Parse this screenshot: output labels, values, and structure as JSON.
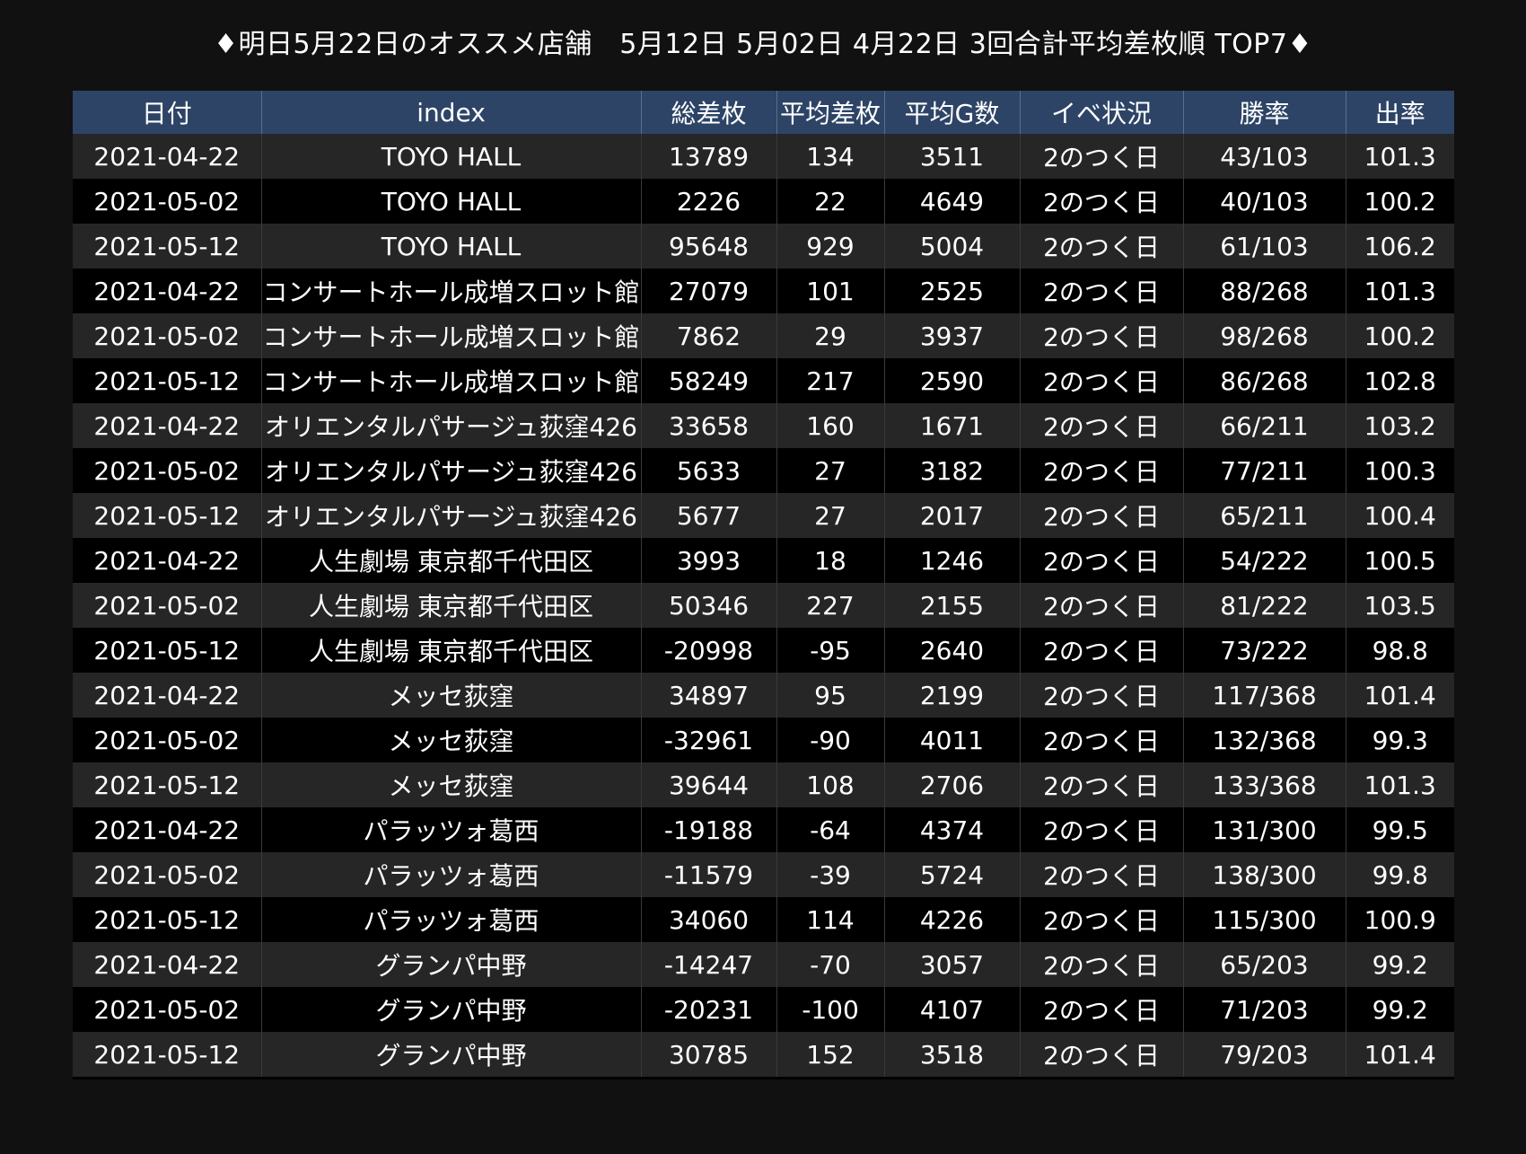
{
  "title": "♦明日5月22日のオススメ店舗　5月12日 5月02日 4月22日  3回合計平均差枚順 TOP7♦",
  "columns": [
    "日付",
    "index",
    "総差枚",
    "平均差枚",
    "平均G数",
    "イベ状況",
    "勝率",
    "出率"
  ],
  "rows": [
    [
      "2021-04-22",
      "TOYO HALL",
      "13789",
      "134",
      "3511",
      "2のつく日",
      "43/103",
      "101.3"
    ],
    [
      "2021-05-02",
      "TOYO HALL",
      "2226",
      "22",
      "4649",
      "2のつく日",
      "40/103",
      "100.2"
    ],
    [
      "2021-05-12",
      "TOYO HALL",
      "95648",
      "929",
      "5004",
      "2のつく日",
      "61/103",
      "106.2"
    ],
    [
      "2021-04-22",
      "コンサートホール成増スロット館",
      "27079",
      "101",
      "2525",
      "2のつく日",
      "88/268",
      "101.3"
    ],
    [
      "2021-05-02",
      "コンサートホール成増スロット館",
      "7862",
      "29",
      "3937",
      "2のつく日",
      "98/268",
      "100.2"
    ],
    [
      "2021-05-12",
      "コンサートホール成増スロット館",
      "58249",
      "217",
      "2590",
      "2のつく日",
      "86/268",
      "102.8"
    ],
    [
      "2021-04-22",
      "オリエンタルパサージュ荻窪426",
      "33658",
      "160",
      "1671",
      "2のつく日",
      "66/211",
      "103.2"
    ],
    [
      "2021-05-02",
      "オリエンタルパサージュ荻窪426",
      "5633",
      "27",
      "3182",
      "2のつく日",
      "77/211",
      "100.3"
    ],
    [
      "2021-05-12",
      "オリエンタルパサージュ荻窪426",
      "5677",
      "27",
      "2017",
      "2のつく日",
      "65/211",
      "100.4"
    ],
    [
      "2021-04-22",
      "人生劇場 東京都千代田区",
      "3993",
      "18",
      "1246",
      "2のつく日",
      "54/222",
      "100.5"
    ],
    [
      "2021-05-02",
      "人生劇場 東京都千代田区",
      "50346",
      "227",
      "2155",
      "2のつく日",
      "81/222",
      "103.5"
    ],
    [
      "2021-05-12",
      "人生劇場 東京都千代田区",
      "-20998",
      "-95",
      "2640",
      "2のつく日",
      "73/222",
      "98.8"
    ],
    [
      "2021-04-22",
      "メッセ荻窪",
      "34897",
      "95",
      "2199",
      "2のつく日",
      "117/368",
      "101.4"
    ],
    [
      "2021-05-02",
      "メッセ荻窪",
      "-32961",
      "-90",
      "4011",
      "2のつく日",
      "132/368",
      "99.3"
    ],
    [
      "2021-05-12",
      "メッセ荻窪",
      "39644",
      "108",
      "2706",
      "2のつく日",
      "133/368",
      "101.3"
    ],
    [
      "2021-04-22",
      "パラッツォ葛西",
      "-19188",
      "-64",
      "4374",
      "2のつく日",
      "131/300",
      "99.5"
    ],
    [
      "2021-05-02",
      "パラッツォ葛西",
      "-11579",
      "-39",
      "5724",
      "2のつく日",
      "138/300",
      "99.8"
    ],
    [
      "2021-05-12",
      "パラッツォ葛西",
      "34060",
      "114",
      "4226",
      "2のつく日",
      "115/300",
      "100.9"
    ],
    [
      "2021-04-22",
      "グランパ中野",
      "-14247",
      "-70",
      "3057",
      "2のつく日",
      "65/203",
      "99.2"
    ],
    [
      "2021-05-02",
      "グランパ中野",
      "-20231",
      "-100",
      "4107",
      "2のつく日",
      "71/203",
      "99.2"
    ],
    [
      "2021-05-12",
      "グランパ中野",
      "30785",
      "152",
      "3518",
      "2のつく日",
      "79/203",
      "101.4"
    ]
  ]
}
